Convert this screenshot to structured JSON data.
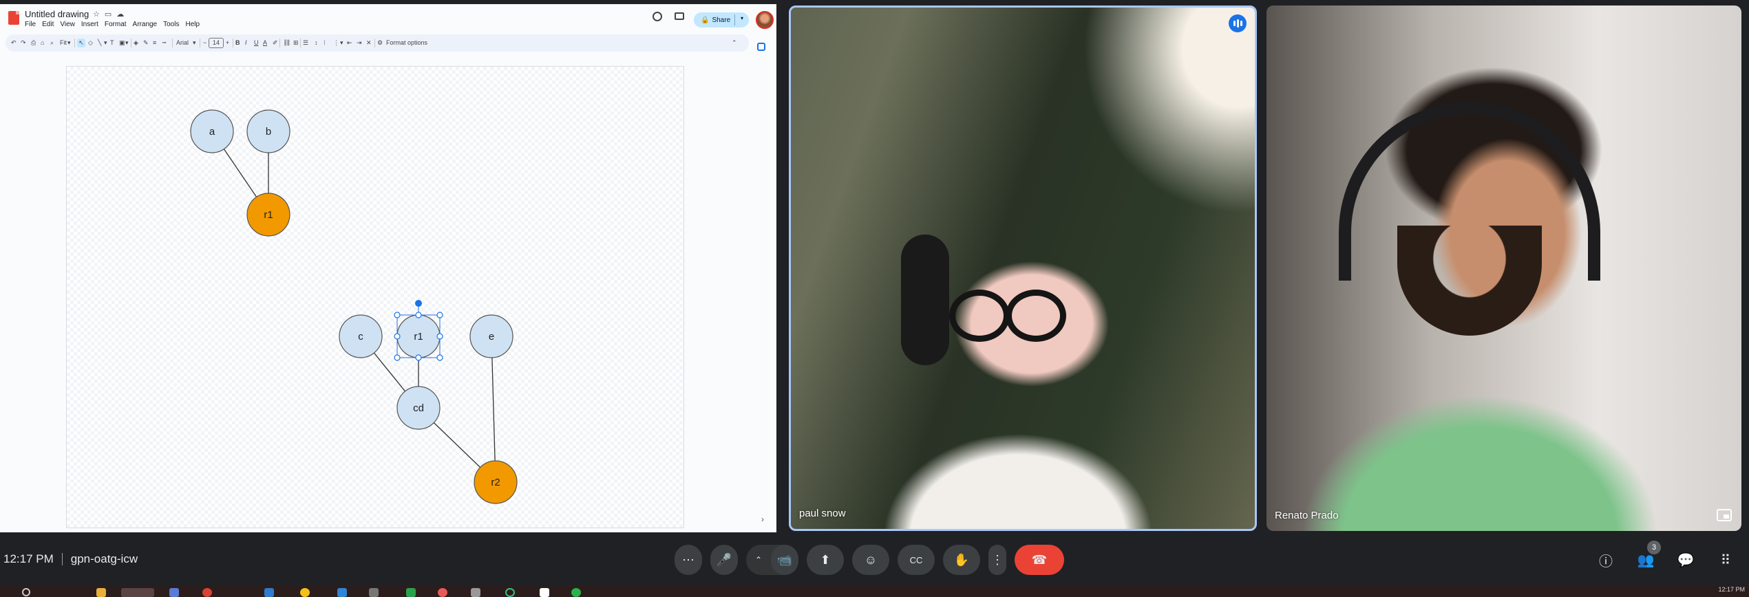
{
  "drawing": {
    "title": "Untitled drawing",
    "menu": [
      "File",
      "Edit",
      "View",
      "Insert",
      "Format",
      "Arrange",
      "Tools",
      "Help"
    ],
    "share_label": "Share",
    "toolbar": {
      "zoom": "Fit",
      "font": "Arial",
      "font_size": "14",
      "format_options": "Format options"
    },
    "nodes": [
      {
        "label": "a",
        "color": "#cfe2f3"
      },
      {
        "label": "b",
        "color": "#cfe2f3"
      },
      {
        "label": "r1",
        "color": "#f29900"
      },
      {
        "label": "c",
        "color": "#cfe2f3"
      },
      {
        "label": "r1",
        "color": "#cfe2f3",
        "selected": true
      },
      {
        "label": "e",
        "color": "#cfe2f3"
      },
      {
        "label": "cd",
        "color": "#cfe2f3"
      },
      {
        "label": "r2",
        "color": "#f29900"
      }
    ],
    "edges": [
      [
        "a",
        "r1"
      ],
      [
        "b",
        "r1"
      ],
      [
        "c",
        "cd"
      ],
      [
        "r1 (selected)",
        "cd"
      ],
      [
        "cd",
        "r2"
      ],
      [
        "e",
        "r2"
      ]
    ]
  },
  "participants": [
    {
      "name": "paul snow",
      "speaking": true
    },
    {
      "name": "Renato Prado",
      "speaking": false
    }
  ],
  "meeting": {
    "time": "12:17 PM",
    "code": "gpn-oatg-icw",
    "people_count": "3"
  },
  "controls": {
    "more_options": "⋯",
    "mic": "🎤",
    "camera": "📹",
    "present": "⬆",
    "emoji": "☺",
    "captions": "CC",
    "raise_hand": "✋",
    "more": "⋮",
    "hangup": "☎"
  },
  "right_controls": {
    "info": "ⓘ",
    "people": "👥",
    "chat": "💬",
    "activities": "⠿"
  },
  "taskbar": {
    "clock": "12:17 PM"
  }
}
